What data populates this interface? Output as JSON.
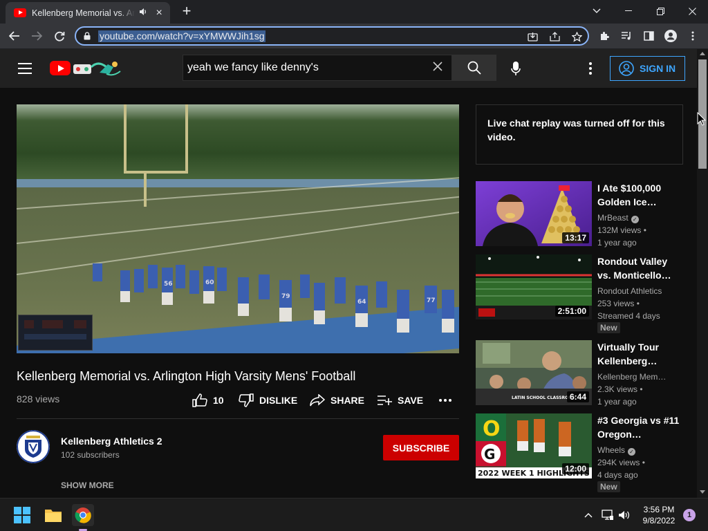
{
  "browser": {
    "tab_title": "Kellenberg Memorial vs. Arlington High Varsity Mens' Football",
    "url": "youtube.com/watch?v=xYMWWJih1sg"
  },
  "header": {
    "search_query": "yeah we fancy like denny's",
    "signin_label": "SIGN IN"
  },
  "video": {
    "title": "Kellenberg Memorial vs. Arlington High Varsity Mens' Football",
    "views": "828 views",
    "likes": "10",
    "dislike_label": "DISLIKE",
    "share_label": "SHARE",
    "save_label": "SAVE"
  },
  "channel": {
    "name": "Kellenberg Athletics 2",
    "subscribers": "102 subscribers",
    "subscribe_label": "SUBSCRIBE",
    "show_more_label": "SHOW MORE"
  },
  "live_chat": {
    "message": "Live chat replay was turned off for this video."
  },
  "recommendations": [
    {
      "title": "I Ate $100,000 Golden Ice…",
      "channel": "MrBeast",
      "verified": true,
      "views": "132M views",
      "age": "1 year ago",
      "duration": "13:17",
      "badge": ""
    },
    {
      "title": "Rondout Valley vs. Monticello…",
      "channel": "Rondout Athletics",
      "verified": false,
      "views": "253 views",
      "age": "Streamed 4 days",
      "duration": "2:51:00",
      "badge": "New"
    },
    {
      "title": "Virtually Tour Kellenberg…",
      "channel": "Kellenberg Mem…",
      "verified": false,
      "views": "2.3K views",
      "age": "1 year ago",
      "duration": "6:44",
      "badge": "",
      "thumb_caption": "LATIN SCHOOL CLASSROOM"
    },
    {
      "title": "#3 Georgia vs #11 Oregon…",
      "channel": "Wheels",
      "verified": true,
      "views": "294K views",
      "age": "4 days ago",
      "duration": "12:00",
      "badge": "New",
      "thumb_caption": "2022 WEEK 1 HIGHLIGHTS"
    }
  ],
  "taskbar": {
    "time": "3:56 PM",
    "date": "9/8/2022",
    "notification_count": "1"
  },
  "colors": {
    "youtube_red": "#ff0000",
    "subscribe_red": "#cc0000",
    "signin_blue": "#3ea6ff",
    "omnibox_focus": "#8ab4f8"
  }
}
